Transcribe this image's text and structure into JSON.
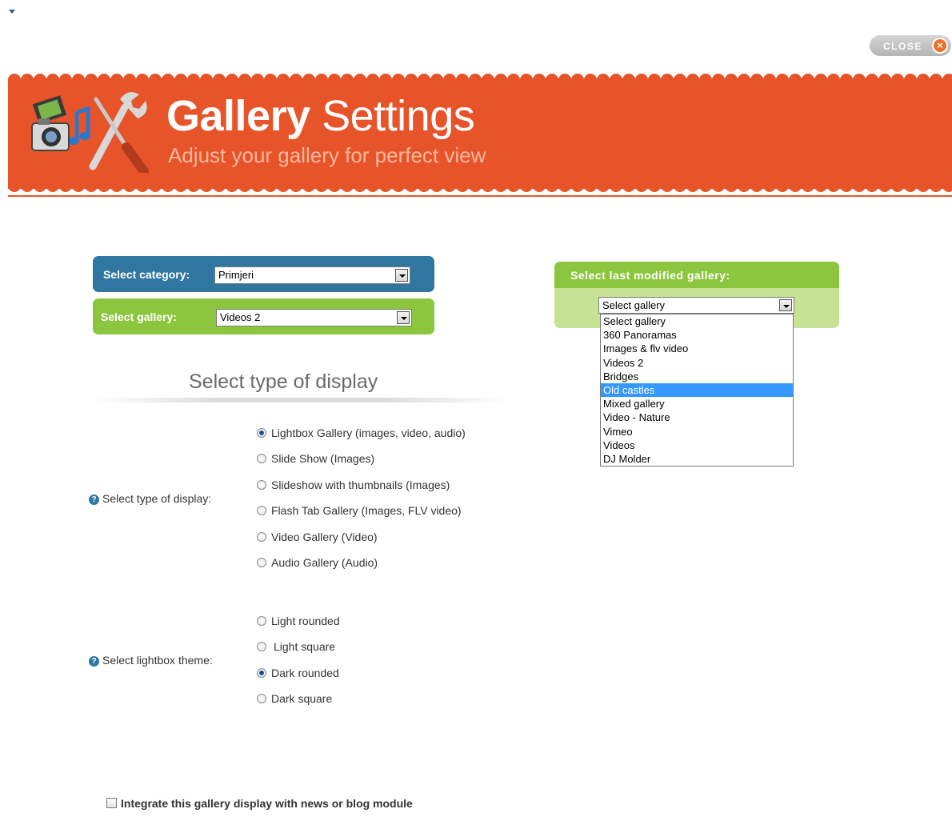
{
  "close_button": {
    "label": "CLOSE",
    "icon": "close-x-icon"
  },
  "header": {
    "title_bold": "Gallery",
    "title_rest": " Settings",
    "subtitle": "Adjust your gallery for perfect view",
    "banner_color": "#e8542a",
    "logo_icon": "camera-tools-icon"
  },
  "category": {
    "label": "Select category:",
    "value": "Primjeri"
  },
  "gallery": {
    "label": "Select gallery:",
    "value": "Videos 2"
  },
  "last_modified": {
    "label": "Select last modified gallery:",
    "value": "Select gallery",
    "options": [
      "Select gallery",
      "360 Panoramas",
      "Images & flv video",
      "Videos 2",
      "Bridges",
      "Old castles",
      "Mixed gallery",
      "Video - Nature",
      "Vimeo",
      "Videos",
      "DJ Molder"
    ],
    "highlighted": "Old castles"
  },
  "display_section": {
    "title": "Select type of display",
    "help_label": "Select type of display:",
    "options": [
      {
        "label": "Lightbox Gallery (images, video, audio)",
        "checked": true
      },
      {
        "label": "Slide Show (Images)",
        "checked": false
      },
      {
        "label": "Slideshow with thumbnails (Images)",
        "checked": false
      },
      {
        "label": "Flash Tab Gallery (Images, FLV video)",
        "checked": false
      },
      {
        "label": "Video Gallery (Video)",
        "checked": false
      },
      {
        "label": "Audio Gallery (Audio)",
        "checked": false
      }
    ]
  },
  "theme_section": {
    "help_label": "Select lightbox theme:",
    "options": [
      {
        "label": "Light rounded",
        "checked": false
      },
      {
        "label": "Light square",
        "checked": false
      },
      {
        "label": "Dark rounded",
        "checked": true
      },
      {
        "label": "Dark square",
        "checked": false
      }
    ]
  },
  "integrate": {
    "label": "Integrate this gallery display with news or blog module",
    "checked": false
  },
  "colors": {
    "blue": "#2f76a1",
    "green": "#8cc63f",
    "orange": "#e8542a"
  }
}
